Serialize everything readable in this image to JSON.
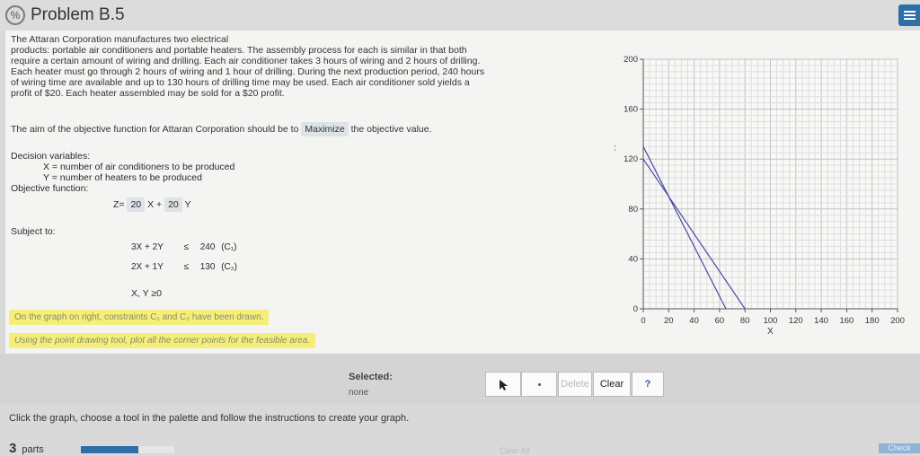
{
  "title": "Problem B.5",
  "problem_text": [
    "The Attaran Corporation manufactures two electrical",
    "products: portable air conditioners and portable heaters. The assembly process for each is similar in that both",
    "require a certain amount of wiring and drilling. Each air conditioner takes 3 hours of wiring and 2 hours of drilling.",
    "Each heater must go through 2 hours of wiring and 1 hour of drilling. During the next production period, 240 hours",
    "of wiring time are available and up to 130 hours of drilling time may be used. Each air conditioner sold yields a",
    "profit of $20. Each heater assembled may be sold for a $20 profit."
  ],
  "aim": {
    "before": "The aim of the objective function for Attaran Corporation should be to",
    "value": "Maximize",
    "after": "the objective value."
  },
  "decision": {
    "heading": "Decision variables:",
    "x_def": "X = number of air conditioners to be produced",
    "y_def": "Y = number of heaters to be produced"
  },
  "objective": {
    "heading": "Objective function:",
    "z_label": "Z=",
    "coef_x": "20",
    "x": "X +",
    "coef_y": "20",
    "y": "Y"
  },
  "subject_to": "Subject to:",
  "constraints": [
    {
      "lhs": "3X + 2Y",
      "op": "≤",
      "rhs": "240",
      "name": "(C₁)"
    },
    {
      "lhs": "2X + 1Y",
      "op": "≤",
      "rhs": "130",
      "name": "(C₂)"
    }
  ],
  "nonneg": "X, Y ≥0",
  "hint1": "On the graph on right, constraints C₁ and C₂ have been drawn.",
  "hint2": "Using the point drawing tool, plot all the corner points for the feasible area.",
  "chart_data": {
    "type": "line",
    "xlabel": "X",
    "ylabel": "Y",
    "xlim": [
      0,
      200
    ],
    "ylim": [
      0,
      200
    ],
    "x_ticks": [
      0,
      20,
      40,
      60,
      80,
      100,
      120,
      140,
      160,
      180,
      200
    ],
    "y_ticks": [
      0,
      40,
      80,
      120,
      160,
      200
    ],
    "grid": true,
    "series": [
      {
        "points": [
          [
            0,
            120
          ],
          [
            80,
            0
          ]
        ]
      },
      {
        "points": [
          [
            0,
            130
          ],
          [
            65,
            0
          ]
        ]
      }
    ],
    "line_color": "#4a4aa8"
  },
  "toolbar": {
    "selected_label": "Selected:",
    "selected_value": "none",
    "pointer_icon": "arrow-cursor-icon",
    "point_icon": "point-icon",
    "delete": "Delete",
    "clear": "Clear",
    "help": "?"
  },
  "instructions": "Click the graph, choose a tool in the palette and follow the instructions to create your graph.",
  "footer": {
    "parts_count": "3",
    "parts_label": "parts",
    "progress": 0.62,
    "clear_all": "Clear All",
    "check": "Check"
  }
}
